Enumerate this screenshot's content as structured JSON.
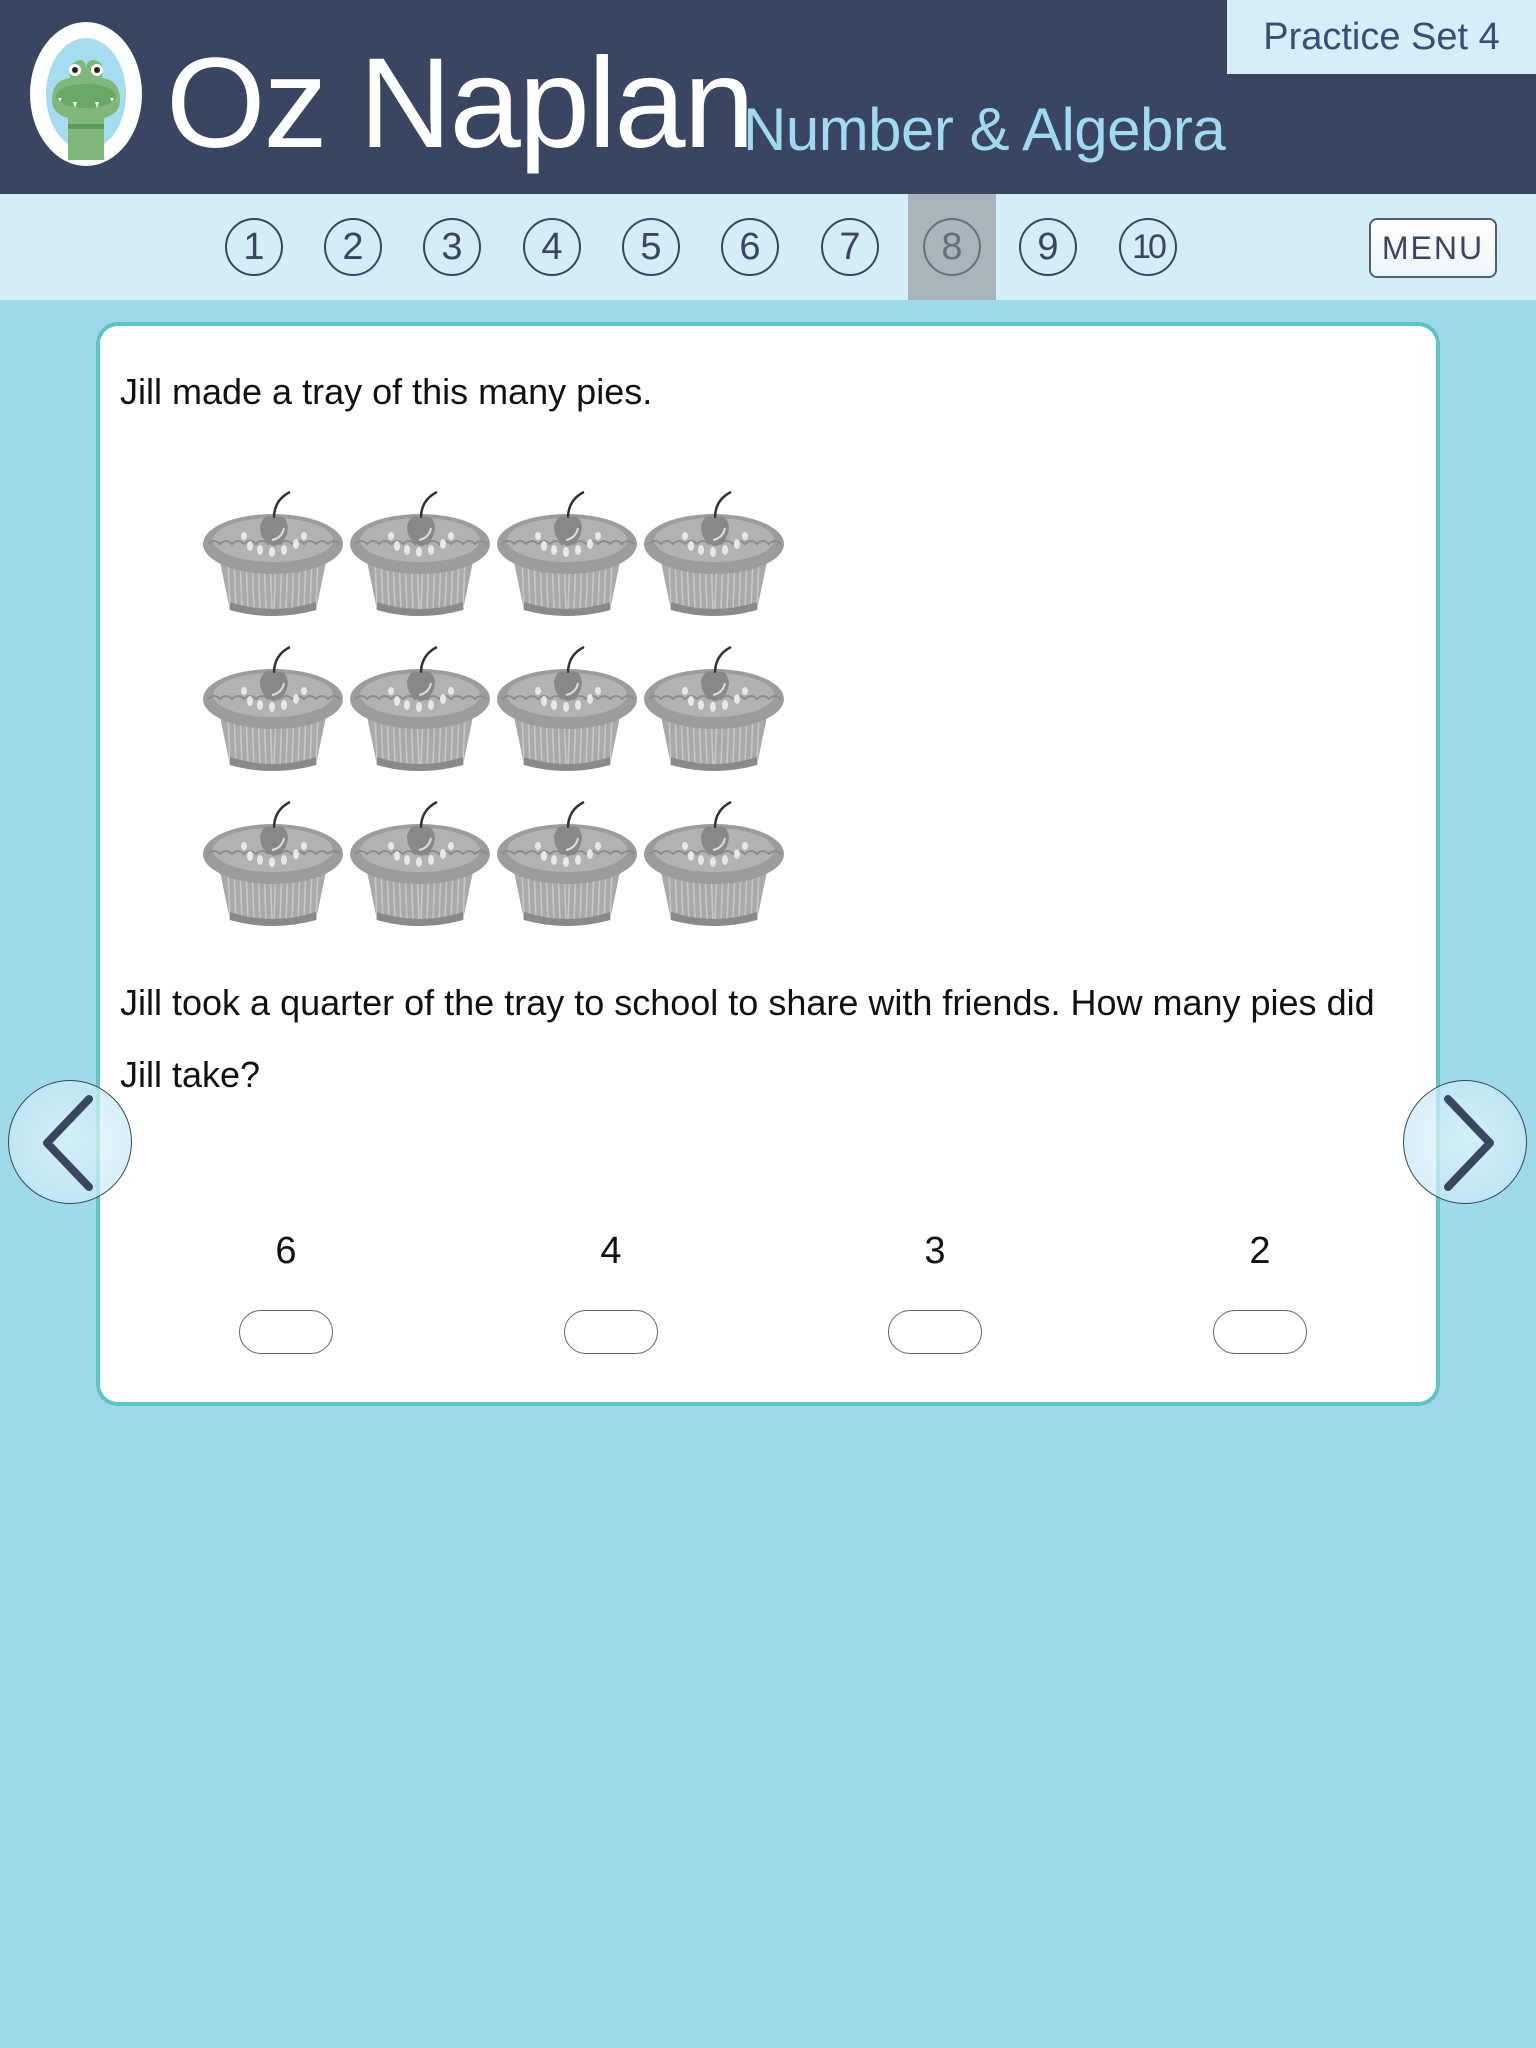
{
  "header": {
    "brand": "Oz Naplan",
    "subject": "Number & Algebra",
    "practice_set": "Practice Set 4",
    "logo_icon": "crocodile-logo-icon"
  },
  "nav": {
    "questions": [
      {
        "label": "1",
        "active": false
      },
      {
        "label": "2",
        "active": false
      },
      {
        "label": "3",
        "active": false
      },
      {
        "label": "4",
        "active": false
      },
      {
        "label": "5",
        "active": false
      },
      {
        "label": "6",
        "active": false
      },
      {
        "label": "7",
        "active": false
      },
      {
        "label": "8",
        "active": true
      },
      {
        "label": "9",
        "active": false
      },
      {
        "label": "10",
        "active": false
      }
    ],
    "menu_label": "MENU"
  },
  "question": {
    "intro": "Jill made a tray of this many pies.",
    "pies": {
      "rows": 3,
      "columns": 4,
      "count": 12,
      "icon": "cherry-pie-icon"
    },
    "prompt": "Jill took a quarter of the tray to school to share with friends. How many pies did Jill take?",
    "answers": [
      {
        "label": "6",
        "selected": false
      },
      {
        "label": "4",
        "selected": false
      },
      {
        "label": "3",
        "selected": false
      },
      {
        "label": "2",
        "selected": false
      }
    ]
  },
  "navigation": {
    "prev_icon": "chevron-left-icon",
    "next_icon": "chevron-right-icon"
  },
  "colors": {
    "header_bg": "#3a4561",
    "nav_bg": "#d4eef8",
    "page_bg": "#9fdaeb",
    "card_border": "#5ec4c6",
    "subject_text": "#9fdaf0",
    "active_question_bg": "#a9b4bb"
  }
}
